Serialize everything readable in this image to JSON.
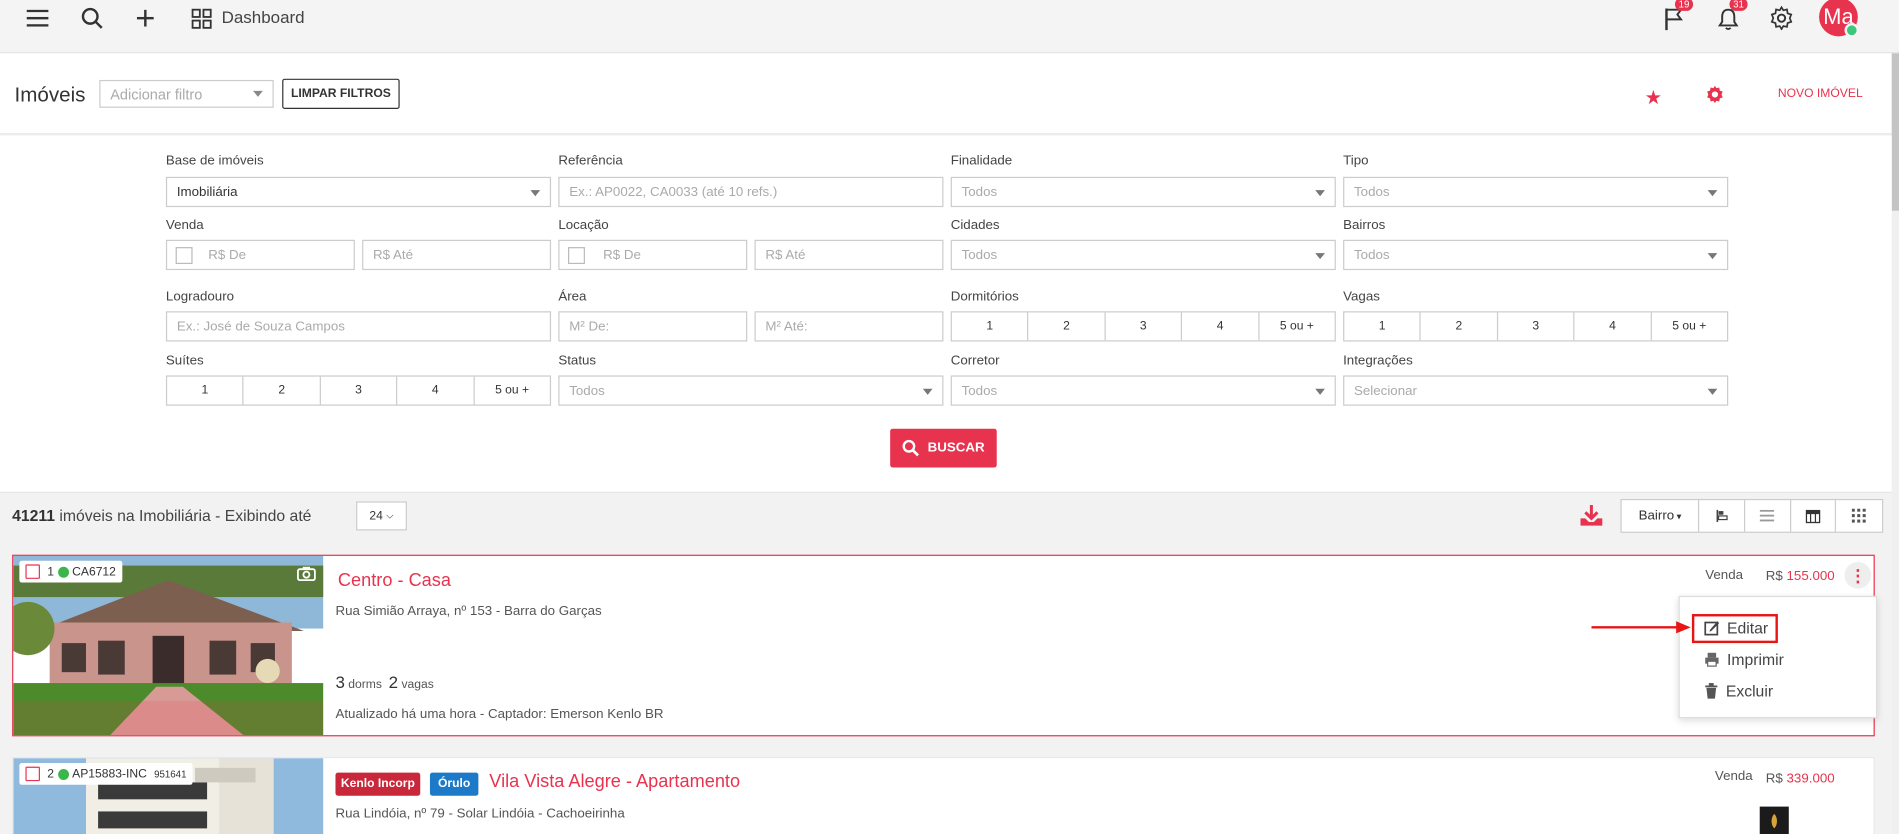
{
  "topbar": {
    "dashboard_label": "Dashboard",
    "flag_badge": "19",
    "bell_badge": "31",
    "avatar_initials": "Ma"
  },
  "header": {
    "title": "Imóveis",
    "filter_placeholder": "Adicionar filtro",
    "clear_label": "LIMPAR FILTROS",
    "new_label": "NOVO IMÓVEL"
  },
  "filters": {
    "base": {
      "label": "Base de imóveis",
      "value": "Imobiliária"
    },
    "referencia": {
      "label": "Referência",
      "placeholder": "Ex.: AP0022, CA0033 (até 10 refs.)"
    },
    "finalidade": {
      "label": "Finalidade",
      "value": "Todos"
    },
    "tipo": {
      "label": "Tipo",
      "value": "Todos"
    },
    "venda": {
      "label": "Venda",
      "from": "R$ De",
      "to": "R$ Até"
    },
    "locacao": {
      "label": "Locação",
      "from": "R$ De",
      "to": "R$ Até"
    },
    "cidades": {
      "label": "Cidades",
      "value": "Todos"
    },
    "bairros": {
      "label": "Bairros",
      "value": "Todos"
    },
    "logradouro": {
      "label": "Logradouro",
      "placeholder": "Ex.: José de Souza Campos"
    },
    "area": {
      "label": "Área",
      "from": "M² De:",
      "to": "M² Até:"
    },
    "dormitorios": {
      "label": "Dormitórios",
      "options": [
        "1",
        "2",
        "3",
        "4",
        "5 ou +"
      ]
    },
    "vagas": {
      "label": "Vagas",
      "options": [
        "1",
        "2",
        "3",
        "4",
        "5 ou +"
      ]
    },
    "suites": {
      "label": "Suítes",
      "options": [
        "1",
        "2",
        "3",
        "4",
        "5 ou +"
      ]
    },
    "status": {
      "label": "Status",
      "value": "Todos"
    },
    "corretor": {
      "label": "Corretor",
      "value": "Todos"
    },
    "integracoes": {
      "label": "Integrações",
      "value": "Selecionar"
    },
    "search_label": "BUSCAR"
  },
  "results": {
    "count": "41211",
    "count_suffix": "imóveis na Imobiliária - Exibindo até",
    "per_page": "24",
    "sort_label": "Bairro"
  },
  "listings": [
    {
      "index": "1",
      "ref": "CA6712",
      "title": "Centro - Casa",
      "address": "Rua Simião Arraya, nº 153 - Barra do Garças",
      "dorms": "3",
      "dorms_label": "dorms",
      "vagas": "2",
      "vagas_label": "vagas",
      "updated": "Atualizado há uma hora - Captador: Emerson Kenlo BR",
      "kind": "Venda",
      "currency": "R$",
      "price": "155.000"
    },
    {
      "index": "2",
      "ref": "AP15883-INC",
      "ref_extra": "951641",
      "tag1": "Kenlo Incorp",
      "tag2": "Órulo",
      "title": "Vila Vista Alegre - Apartamento",
      "address": "Rua Lindóia, nº 79 - Solar Lindóia - Cachoeirinha",
      "kind": "Venda",
      "currency": "R$",
      "price": "339.000"
    }
  ],
  "context_menu": {
    "items": [
      "Editar",
      "Imprimir",
      "Excluir"
    ]
  },
  "colors": {
    "accent": "#e8334f",
    "highlight": "#e81515",
    "online": "#3cb54a"
  }
}
